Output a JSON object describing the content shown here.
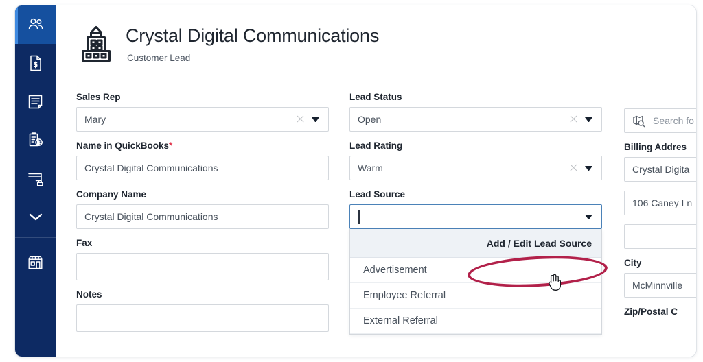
{
  "sidebar": {
    "items": [
      {
        "name": "contacts",
        "icon": "users-icon",
        "active": true
      },
      {
        "name": "invoices",
        "icon": "invoice-document-icon",
        "active": false
      },
      {
        "name": "forms",
        "icon": "form-list-icon",
        "active": false
      },
      {
        "name": "estimates",
        "icon": "clipboard-dollar-icon",
        "active": false
      },
      {
        "name": "payments",
        "icon": "card-lock-icon",
        "active": false
      },
      {
        "name": "more",
        "icon": "chevron-down-icon",
        "active": false
      },
      {
        "name": "store",
        "icon": "storefront-icon",
        "active": false
      }
    ]
  },
  "header": {
    "title": "Crystal Digital Communications",
    "subtitle": "Customer Lead",
    "icon": "building-icon"
  },
  "form": {
    "left_column": [
      {
        "label": "Sales Rep",
        "required": false,
        "value": "Mary",
        "type": "select",
        "has_clear": true
      },
      {
        "label": "Name in QuickBooks",
        "required": true,
        "value": "Crystal Digital Communications",
        "type": "text",
        "has_clear": false
      },
      {
        "label": "Company Name",
        "required": false,
        "value": "Crystal Digital Communications",
        "type": "text",
        "has_clear": false
      },
      {
        "label": "Fax",
        "required": false,
        "value": "",
        "type": "text",
        "has_clear": false
      },
      {
        "label": "Notes",
        "required": false,
        "value": "",
        "type": "textarea",
        "has_clear": false
      }
    ],
    "middle_column": [
      {
        "label": "Lead Status",
        "required": false,
        "value": "Open",
        "type": "select",
        "has_clear": true
      },
      {
        "label": "Lead Rating",
        "required": false,
        "value": "Warm",
        "type": "select",
        "has_clear": true
      },
      {
        "label": "Lead Source",
        "required": false,
        "value": "",
        "type": "select-open",
        "has_clear": false
      }
    ],
    "right_column": {
      "search_field": {
        "placeholder": "Search fo",
        "icon": "map-search-icon"
      },
      "billing_address_label": "Billing Addres",
      "address_lines": [
        "Crystal Digita",
        "106 Caney Ln",
        ""
      ],
      "city_label": "City",
      "city_value": "McMinnville",
      "zip_label": "Zip/Postal C"
    }
  },
  "lead_source_dropdown": {
    "add_edit_label": "Add / Edit Lead Source",
    "options": [
      "Advertisement",
      "Employee Referral",
      "External Referral"
    ]
  },
  "annotation": {
    "shape": "ellipse",
    "color": "#b2214a",
    "target": "Add / Edit Lead Source",
    "cursor": "hand-pointer-cursor"
  },
  "colors": {
    "sidebar_bg": "#0d2a63",
    "sidebar_active_bg": "#15509f",
    "sidebar_accent": "#3f8ae0",
    "focus_border": "#4b82b8",
    "dropdown_header_bg": "#eef2f6",
    "required_asterisk": "#e2364d",
    "annotation_red": "#b2214a"
  }
}
